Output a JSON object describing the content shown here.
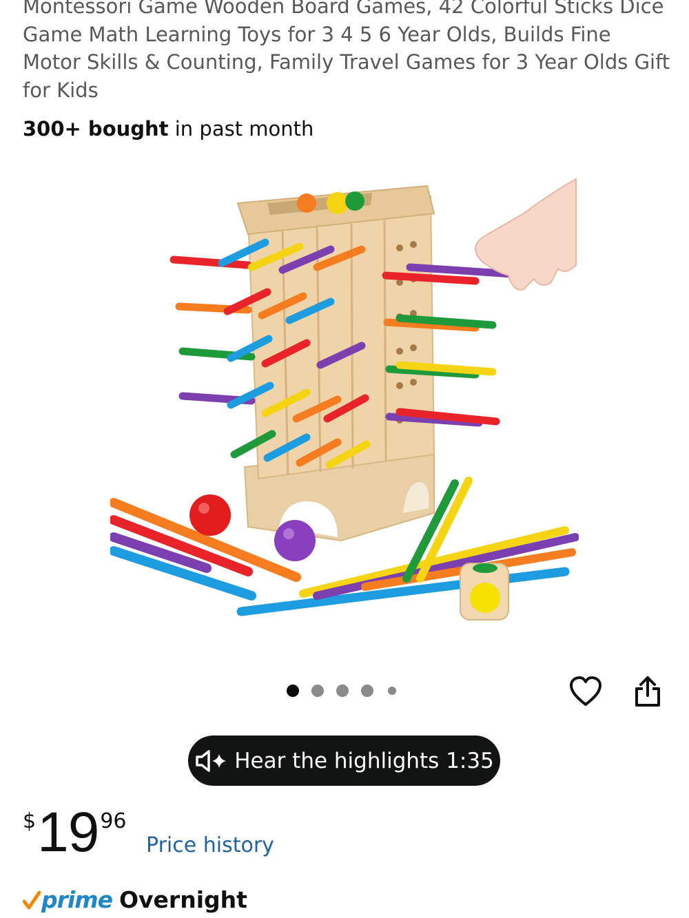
{
  "product": {
    "title": "Montessori Game Wooden Board Games, 42 Colorful Sticks Dice Game Math Learning Toys for 3 4 5 6 Year Olds, Builds Fine Motor Skills & Counting, Family Travel Games for 3 Year Olds Gift for Kids",
    "bought_count": "300+ bought",
    "bought_suffix": " in past month"
  },
  "gallery": {
    "image_count": 5,
    "active_index": 0,
    "image_alt": "wooden-stick-tower-toy"
  },
  "actions": {
    "favorite_icon": "heart-icon",
    "share_icon": "share-icon"
  },
  "audio": {
    "label": "Hear the highlights 1:35",
    "icon": "speaker-sparkle-icon"
  },
  "price": {
    "currency": "$",
    "whole": "19",
    "fraction": "96",
    "history_link": "Price history"
  },
  "delivery": {
    "prime_label": "prime",
    "speed": "Overnight",
    "brand_color": "#1f86c7",
    "check_color": "#f08804"
  }
}
